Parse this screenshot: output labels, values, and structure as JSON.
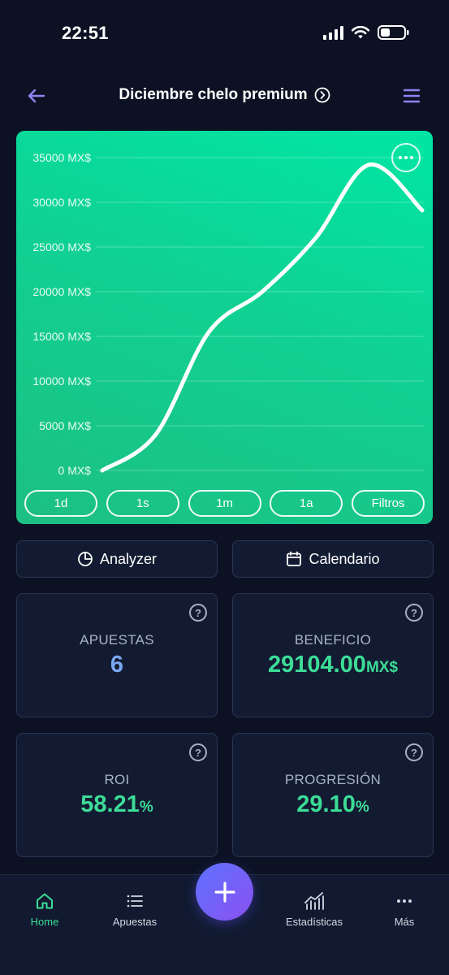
{
  "status_bar": {
    "time": "22:51",
    "icons": [
      "signal-icon",
      "wifi-icon",
      "battery-icon"
    ]
  },
  "header": {
    "title": "Diciembre chelo premium",
    "icons": [
      "back-arrow-icon",
      "chevron-circle-icon",
      "menu-icon"
    ]
  },
  "chart_data": {
    "type": "area",
    "y_ticks": [
      "35000 MX$",
      "30000 MX$",
      "25000 MX$",
      "20000 MX$",
      "15000 MX$",
      "10000 MX$",
      "5000 MX$",
      "0 MX$"
    ],
    "ylim": [
      0,
      35000
    ],
    "x": [
      0,
      1,
      2,
      3,
      4,
      5,
      6
    ],
    "values": [
      0,
      4000,
      15500,
      20000,
      26000,
      34200,
      29104
    ],
    "grid": true,
    "line_color": "#ffffff",
    "background": "#10d192"
  },
  "ranges": [
    "1d",
    "1s",
    "1m",
    "1a",
    "Filtros"
  ],
  "actions": {
    "analyzer": "Analyzer",
    "calendar": "Calendario"
  },
  "stats": [
    {
      "label": "APUESTAS",
      "value": "6",
      "unit": "",
      "color": "#7aa7f0"
    },
    {
      "label": "BENEFICIO",
      "value": "29104.00",
      "unit": "MX$",
      "color": "#3ddc97"
    },
    {
      "label": "ROI",
      "value": "58.21",
      "unit": "%",
      "color": "#3ddc97"
    },
    {
      "label": "PROGRESIÓN",
      "value": "29.10",
      "unit": "%",
      "color": "#3ddc97"
    }
  ],
  "nav": {
    "home": "Home",
    "bets": "Apuestas",
    "stats": "Estadísticas",
    "more": "Más",
    "accent": "#3ddc97"
  }
}
